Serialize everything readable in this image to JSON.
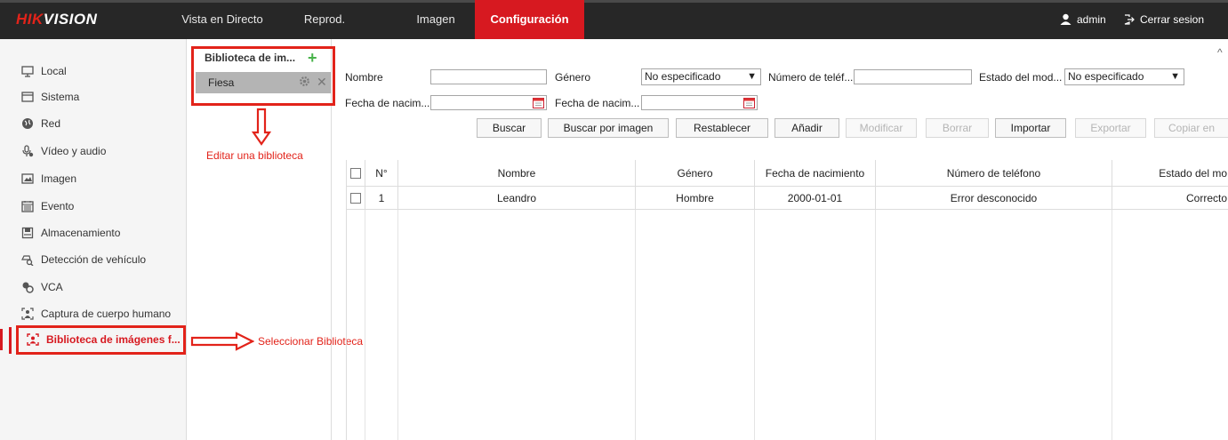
{
  "header": {
    "logo_prefix": "HIK",
    "logo_suffix": "VISION",
    "nav": [
      "Vista en Directo",
      "Reprod.",
      "Imagen",
      "Configuración"
    ],
    "active_nav": "Configuración",
    "user": "admin",
    "logout": "Cerrar sesion"
  },
  "sidebar": {
    "items": [
      {
        "label": "Local",
        "icon": "monitor-icon"
      },
      {
        "label": "Sistema",
        "icon": "window-icon"
      },
      {
        "label": "Red",
        "icon": "globe-icon"
      },
      {
        "label": "Vídeo y audio",
        "icon": "microphone-icon"
      },
      {
        "label": "Imagen",
        "icon": "image-icon"
      },
      {
        "label": "Evento",
        "icon": "calendar-icon"
      },
      {
        "label": "Almacenamiento",
        "icon": "disk-icon"
      },
      {
        "label": "Detección de vehículo",
        "icon": "vehicle-search-icon"
      },
      {
        "label": "VCA",
        "icon": "vca-icon"
      },
      {
        "label": "Captura de cuerpo humano",
        "icon": "body-capture-icon"
      },
      {
        "label": "Biblioteca de imágenes f...",
        "icon": "face-library-icon",
        "active": true
      }
    ]
  },
  "library": {
    "title": "Biblioteca de im...",
    "items": [
      "Fiesa"
    ]
  },
  "annotations": {
    "edit": "Editar una biblioteca",
    "select": "Seleccionar Biblioteca"
  },
  "search": {
    "name_label": "Nombre",
    "gender_label": "Género",
    "gender_value": "No especificado",
    "phone_label": "Número de teléf...",
    "state_label": "Estado del mod...",
    "state_value": "No especificado",
    "birth_from_label": "Fecha de nacim...",
    "birth_to_label": "Fecha de nacim..."
  },
  "buttons": {
    "buscar": "Buscar",
    "buscar_imagen": "Buscar por imagen",
    "restablecer": "Restablecer",
    "anadir": "Añadir",
    "modificar": "Modificar",
    "borrar": "Borrar",
    "importar": "Importar",
    "exportar": "Exportar",
    "copiar": "Copiar en"
  },
  "table": {
    "columns": [
      "N°",
      "Nombre",
      "Género",
      "Fecha de nacimiento",
      "Número de teléfono",
      "Estado del mo"
    ],
    "rows": [
      {
        "n": "1",
        "nombre": "Leandro",
        "genero": "Hombre",
        "fecha": "2000-01-01",
        "telefono": "Error desconocido",
        "estado": "Correcto"
      }
    ]
  },
  "colors": {
    "accent": "#d71920",
    "topbar": "#272727",
    "annotation": "#e2231a",
    "add": "#48b34a"
  }
}
